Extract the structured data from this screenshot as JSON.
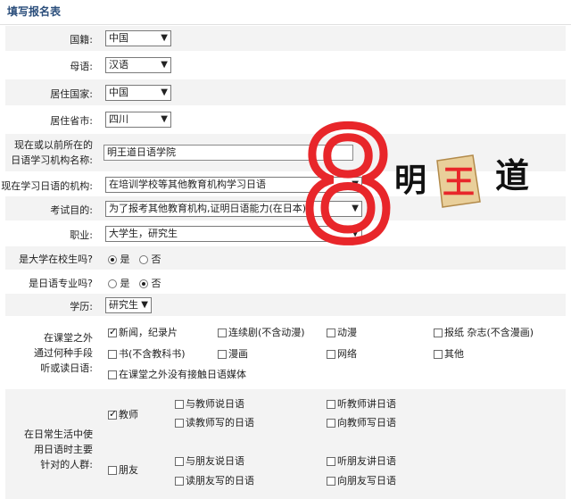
{
  "form_title": "填写报名表",
  "rows": {
    "nationality": {
      "label": "国籍:",
      "value": "中国"
    },
    "native_lang": {
      "label": "母语:",
      "value": "汉语"
    },
    "country": {
      "label": "居住国家:",
      "value": "中国"
    },
    "province": {
      "label": "居住省市:",
      "value": "四川"
    },
    "institution": {
      "label1": "现在或以前所在的",
      "label2": "日语学习机构名称:",
      "value": "明王道日语学院"
    },
    "org_type": {
      "label": "现在学习日语的机构:",
      "value": "在培训学校等其他教育机构学习日语"
    },
    "purpose": {
      "label": "考试目的:",
      "value": "为了报考其他教育机构,证明日语能力(在日本)"
    },
    "occupation": {
      "label": "职业:",
      "value": "大学生，研究生"
    },
    "is_student": {
      "label": "是大学在校生吗?",
      "yes": "是",
      "no": "否",
      "selected": "yes"
    },
    "is_major": {
      "label": "是日语专业吗?",
      "yes": "是",
      "no": "否",
      "selected": "no"
    },
    "education": {
      "label": "学历:",
      "value": "研究生"
    }
  },
  "media": {
    "label1": "在课堂之外",
    "label2": "通过何种手段",
    "label3": "听或读日语:",
    "options": [
      {
        "text": "新闻，纪录片",
        "checked": true
      },
      {
        "text": "连续剧(不含动漫)",
        "checked": false
      },
      {
        "text": "动漫",
        "checked": false
      },
      {
        "text": "报纸 杂志(不含漫画)",
        "checked": false
      },
      {
        "text": "书(不含教科书)",
        "checked": false
      },
      {
        "text": "漫画",
        "checked": false
      },
      {
        "text": "网络",
        "checked": false
      },
      {
        "text": "其他",
        "checked": false
      },
      {
        "text": "在课堂之外没有接触日语媒体",
        "checked": false
      }
    ]
  },
  "targets": {
    "label1": "在日常生活中使",
    "label2": "用日语时主要",
    "label3": "针对的人群:",
    "teacher": {
      "text": "教师",
      "checked": true,
      "subs": [
        "与教师说日语",
        "听教师讲日语",
        "读教师写的日语",
        "向教师写日语"
      ]
    },
    "friend": {
      "text": "朋友",
      "checked": false,
      "subs": [
        "与朋友说日语",
        "听朋友讲日语",
        "读朋友写的日语",
        "向朋友写日语"
      ]
    }
  },
  "watermark": {
    "number": "8",
    "logo_text": [
      "明",
      "王",
      "道"
    ],
    "color": "#e8262a"
  },
  "colors": {
    "title": "#2c4f7c",
    "row_bg": "#f3f3f3",
    "border": "#7a7a7a"
  }
}
